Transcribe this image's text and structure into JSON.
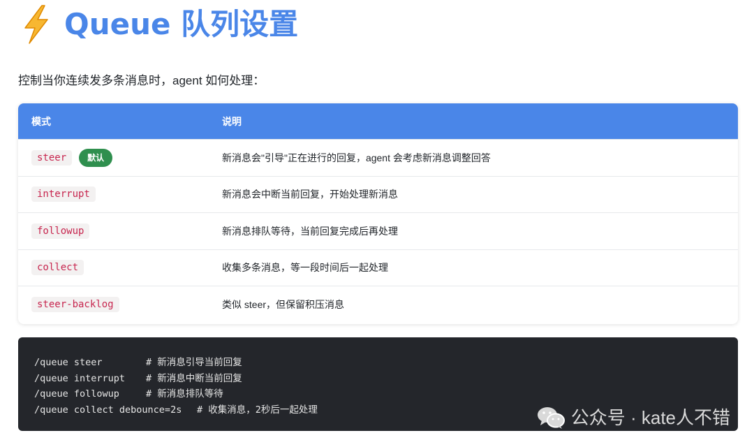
{
  "title": {
    "icon": "lightning-bolt-icon",
    "text": "Queue 队列设置"
  },
  "intro": "控制当你连续发多条消息时，agent 如何处理：",
  "table": {
    "headers": {
      "mode": "模式",
      "desc": "说明"
    },
    "default_badge": "默认",
    "rows": [
      {
        "mode": "steer",
        "desc": "新消息会\"引导\"正在进行的回复，agent 会考虑新消息调整回答"
      },
      {
        "mode": "interrupt",
        "desc": "新消息会中断当前回复，开始处理新消息"
      },
      {
        "mode": "followup",
        "desc": "新消息排队等待，当前回复完成后再处理"
      },
      {
        "mode": "collect",
        "desc": "收集多条消息，等一段时间后一起处理"
      },
      {
        "mode": "steer-backlog",
        "desc": "类似 steer，但保留积压消息"
      }
    ]
  },
  "code": {
    "lines": [
      {
        "cmd": "/queue steer",
        "comment": "# 新消息引导当前回复"
      },
      {
        "cmd": "/queue interrupt",
        "comment": "# 新消息中断当前回复"
      },
      {
        "cmd": "/queue followup",
        "comment": "# 新消息排队等待"
      },
      {
        "cmd": "/queue collect debounce=2s",
        "comment": "# 收集消息，2秒后一起处理"
      }
    ]
  },
  "watermark": {
    "icon": "wechat-icon",
    "text": "公众号 · kate人不错"
  },
  "colors": {
    "accent": "#4a86e8",
    "badge": "#2f8f4e",
    "code_bg": "#24262b",
    "code_tag": "#c7254e"
  }
}
